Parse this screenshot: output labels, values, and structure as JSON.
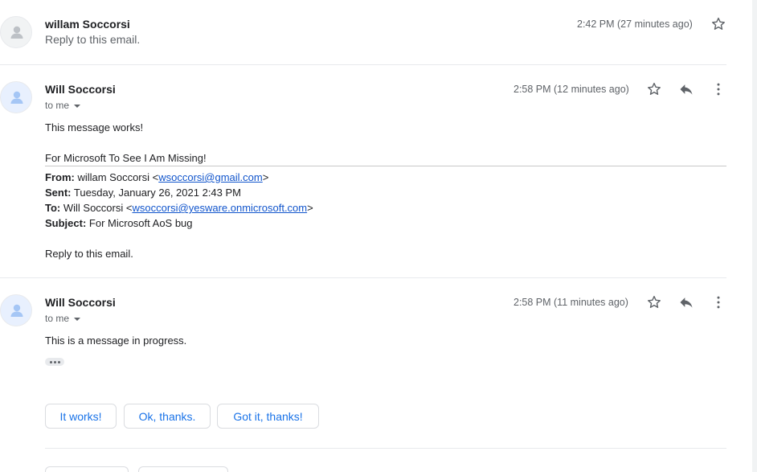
{
  "messages": [
    {
      "sender": "willam Soccorsi",
      "snippet": "Reply to this email.",
      "time": "2:42 PM (27 minutes ago)"
    },
    {
      "sender": "Will Soccorsi",
      "recipient_label": "to me",
      "time": "2:58 PM (12 minutes ago)",
      "body_line1": "This message works!",
      "body_line2": "For Microsoft To See I Am Missing!",
      "quoted": {
        "from_label": "From:",
        "from_name": " willam Soccorsi <",
        "from_email": "wsoccorsi@gmail.com",
        "from_close": ">",
        "sent_label": "Sent:",
        "sent_value": " Tuesday, January 26, 2021 2:43 PM",
        "to_label": "To:",
        "to_name": " Will Soccorsi <",
        "to_email": "wsoccorsi@yesware.onmicrosoft.com",
        "to_close": ">",
        "subject_label": "Subject:",
        "subject_value": " For Microsoft AoS bug",
        "reply_line": "Reply to this email."
      }
    },
    {
      "sender": "Will Soccorsi",
      "recipient_label": "to me",
      "time": "2:58 PM (11 minutes ago)",
      "body_line1": "This is a message in progress."
    }
  ],
  "smart_replies": [
    "It works!",
    "Ok, thanks.",
    "Got it, thanks!"
  ],
  "colors": {
    "accent": "#1a73e8",
    "link": "#1155cc",
    "icon": "#5f6368"
  },
  "icons": {
    "star": "star-icon",
    "reply": "reply-icon",
    "more": "more-vert-icon",
    "avatar": "person-icon"
  }
}
